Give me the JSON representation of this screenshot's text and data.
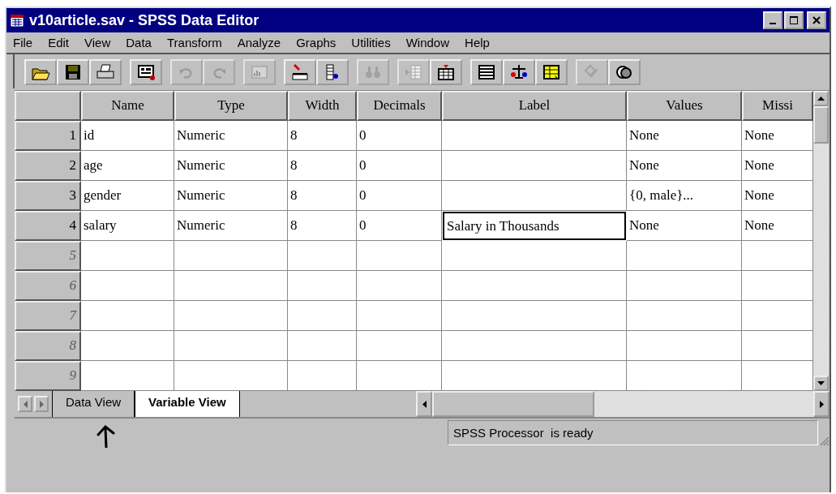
{
  "window": {
    "title": "v10article.sav - SPSS Data Editor"
  },
  "menu": [
    "File",
    "Edit",
    "View",
    "Data",
    "Transform",
    "Analyze",
    "Graphs",
    "Utilities",
    "Window",
    "Help"
  ],
  "toolbar": [
    [
      {
        "kind": "open",
        "disabled": false
      },
      {
        "kind": "save",
        "disabled": false
      },
      {
        "kind": "print",
        "disabled": false
      }
    ],
    [
      {
        "kind": "dialog",
        "disabled": false
      }
    ],
    [
      {
        "kind": "undo",
        "disabled": true
      },
      {
        "kind": "redo",
        "disabled": true
      }
    ],
    [
      {
        "kind": "chart",
        "disabled": true
      }
    ],
    [
      {
        "kind": "gotocase",
        "disabled": false
      },
      {
        "kind": "variables",
        "disabled": false
      }
    ],
    [
      {
        "kind": "find",
        "disabled": true
      }
    ],
    [
      {
        "kind": "insertvar",
        "disabled": true
      },
      {
        "kind": "insertcase",
        "disabled": false
      }
    ],
    [
      {
        "kind": "split",
        "disabled": false
      },
      {
        "kind": "weight",
        "disabled": false
      },
      {
        "kind": "select",
        "disabled": false
      }
    ],
    [
      {
        "kind": "labels",
        "disabled": true
      },
      {
        "kind": "sets",
        "disabled": false
      }
    ]
  ],
  "table": {
    "columns": [
      "Name",
      "Type",
      "Width",
      "Decimals",
      "Label",
      "Values",
      "Missi"
    ],
    "rows": [
      {
        "number": "1",
        "defined": true,
        "cells": [
          {
            "text": "id",
            "selected": false
          },
          {
            "text": "Numeric",
            "selected": false
          },
          {
            "text": "8",
            "selected": false
          },
          {
            "text": "0",
            "selected": false
          },
          {
            "selected": false
          },
          {
            "text": "None",
            "selected": false
          },
          {
            "text": "None",
            "selected": false
          }
        ]
      },
      {
        "number": "2",
        "defined": true,
        "cells": [
          {
            "text": "age",
            "selected": false
          },
          {
            "text": "Numeric",
            "selected": false
          },
          {
            "text": "8",
            "selected": false
          },
          {
            "text": "0",
            "selected": false
          },
          {
            "selected": false
          },
          {
            "text": "None",
            "selected": false
          },
          {
            "text": "None",
            "selected": false
          }
        ]
      },
      {
        "number": "3",
        "defined": true,
        "cells": [
          {
            "text": "gender",
            "selected": false
          },
          {
            "text": "Numeric",
            "selected": false
          },
          {
            "text": "8",
            "selected": false
          },
          {
            "text": "0",
            "selected": false
          },
          {
            "selected": false
          },
          {
            "text": "{0, male}...",
            "selected": false
          },
          {
            "text": "None",
            "selected": false
          }
        ]
      },
      {
        "number": "4",
        "defined": true,
        "cells": [
          {
            "text": "salary",
            "selected": false
          },
          {
            "text": "Numeric",
            "selected": false
          },
          {
            "text": "8",
            "selected": false
          },
          {
            "text": "0",
            "selected": false
          },
          {
            "text": "Salary in Thousands",
            "selected": true
          },
          {
            "text": "None",
            "selected": false
          },
          {
            "text": "None",
            "selected": false
          }
        ]
      },
      {
        "number": "5",
        "defined": false
      },
      {
        "number": "6",
        "defined": false
      },
      {
        "number": "7",
        "defined": false
      },
      {
        "number": "8",
        "defined": false
      },
      {
        "number": "9",
        "defined": false
      }
    ]
  },
  "tabs": [
    {
      "label": "Data View",
      "selected": false
    },
    {
      "label": "Variable View",
      "selected": true
    }
  ],
  "status_bar": "SPSS Processor  is ready"
}
